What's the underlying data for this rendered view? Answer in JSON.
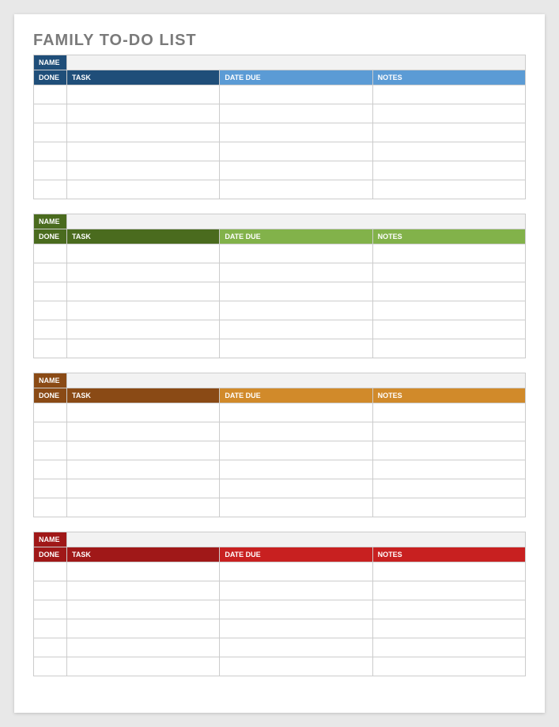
{
  "title": "FAMILY TO-DO LIST",
  "labels": {
    "name": "NAME",
    "done": "DONE",
    "task": "TASK",
    "date_due": "DATE DUE",
    "notes": "NOTES"
  },
  "sections": [
    {
      "theme": "blue",
      "name_value": "",
      "rows": [
        {
          "done": "",
          "task": "",
          "date_due": "",
          "notes": ""
        },
        {
          "done": "",
          "task": "",
          "date_due": "",
          "notes": ""
        },
        {
          "done": "",
          "task": "",
          "date_due": "",
          "notes": ""
        },
        {
          "done": "",
          "task": "",
          "date_due": "",
          "notes": ""
        },
        {
          "done": "",
          "task": "",
          "date_due": "",
          "notes": ""
        },
        {
          "done": "",
          "task": "",
          "date_due": "",
          "notes": ""
        }
      ]
    },
    {
      "theme": "green",
      "name_value": "",
      "rows": [
        {
          "done": "",
          "task": "",
          "date_due": "",
          "notes": ""
        },
        {
          "done": "",
          "task": "",
          "date_due": "",
          "notes": ""
        },
        {
          "done": "",
          "task": "",
          "date_due": "",
          "notes": ""
        },
        {
          "done": "",
          "task": "",
          "date_due": "",
          "notes": ""
        },
        {
          "done": "",
          "task": "",
          "date_due": "",
          "notes": ""
        },
        {
          "done": "",
          "task": "",
          "date_due": "",
          "notes": ""
        }
      ]
    },
    {
      "theme": "orange",
      "name_value": "",
      "rows": [
        {
          "done": "",
          "task": "",
          "date_due": "",
          "notes": ""
        },
        {
          "done": "",
          "task": "",
          "date_due": "",
          "notes": ""
        },
        {
          "done": "",
          "task": "",
          "date_due": "",
          "notes": ""
        },
        {
          "done": "",
          "task": "",
          "date_due": "",
          "notes": ""
        },
        {
          "done": "",
          "task": "",
          "date_due": "",
          "notes": ""
        },
        {
          "done": "",
          "task": "",
          "date_due": "",
          "notes": ""
        }
      ]
    },
    {
      "theme": "red",
      "name_value": "",
      "rows": [
        {
          "done": "",
          "task": "",
          "date_due": "",
          "notes": ""
        },
        {
          "done": "",
          "task": "",
          "date_due": "",
          "notes": ""
        },
        {
          "done": "",
          "task": "",
          "date_due": "",
          "notes": ""
        },
        {
          "done": "",
          "task": "",
          "date_due": "",
          "notes": ""
        },
        {
          "done": "",
          "task": "",
          "date_due": "",
          "notes": ""
        },
        {
          "done": "",
          "task": "",
          "date_due": "",
          "notes": ""
        }
      ]
    }
  ]
}
